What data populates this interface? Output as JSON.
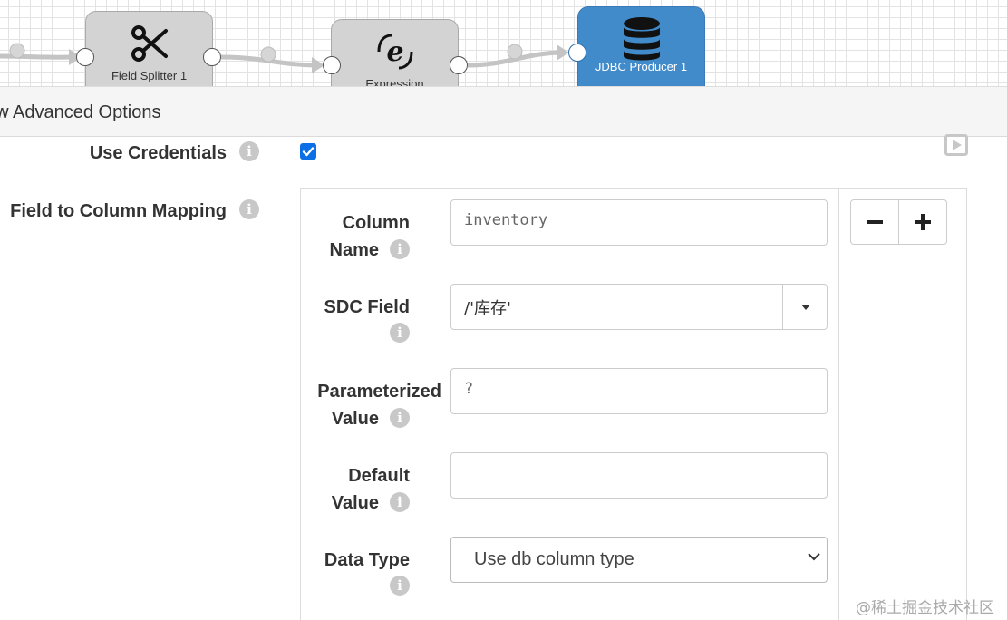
{
  "pipeline": {
    "stages": [
      {
        "label": "Field Splitter 1",
        "icon": "scissors-icon",
        "selected": false
      },
      {
        "label": "Expression",
        "icon": "expression-icon",
        "selected": false
      },
      {
        "label": "JDBC Producer 1",
        "icon": "database-icon",
        "selected": true
      }
    ]
  },
  "advanced_bar": {
    "label": "ow Advanced Options"
  },
  "form": {
    "use_credentials": {
      "label": "Use Credentials",
      "checked": true
    },
    "field_mapping": {
      "label": "Field to Column Mapping",
      "column_name": {
        "label_line1": "Column",
        "label_line2": "Name",
        "value": "inventory"
      },
      "sdc_field": {
        "label": "SDC Field",
        "value": "/'库存'"
      },
      "parameterized_value": {
        "label_line1": "Parameterized",
        "label_line2": "Value",
        "value": "?"
      },
      "default_value": {
        "label_line1": "Default",
        "label_line2": "Value",
        "value": ""
      },
      "data_type": {
        "label": "Data Type",
        "value": "Use db column type"
      },
      "remove_label": "−",
      "add_label": "+"
    }
  },
  "watermark": "@稀土掘金技术社区",
  "colors": {
    "accent": "#428bca",
    "checkbox": "#0b6fe6",
    "stage_bg": "#d3d3d3"
  }
}
